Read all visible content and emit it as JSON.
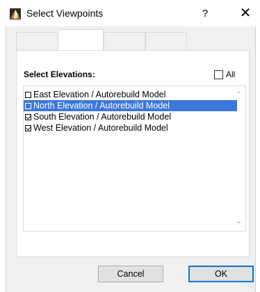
{
  "window": {
    "title": "Select Viewpoints",
    "help_glyph": "?",
    "close_glyph": "✕"
  },
  "panel": {
    "section_label": "Select Elevations:",
    "all_label": "All",
    "all_checked": false
  },
  "list": {
    "items": [
      {
        "label": "East Elevation / Autorebuild Model",
        "checked": false,
        "selected": false
      },
      {
        "label": "North Elevation / Autorebuild Model",
        "checked": false,
        "selected": true
      },
      {
        "label": "South Elevation / Autorebuild Model",
        "checked": true,
        "selected": false
      },
      {
        "label": "West Elevation / Autorebuild Model",
        "checked": true,
        "selected": false
      }
    ]
  },
  "buttons": {
    "cancel": "Cancel",
    "ok": "OK"
  },
  "icons": {
    "app": "archicad-icon",
    "scroll_up": "chevron-up-icon",
    "scroll_down": "chevron-down-icon"
  },
  "colors": {
    "selection": "#3c78d8",
    "dialog_bg": "#f0f0f0",
    "default_button_border": "#0078d7"
  }
}
